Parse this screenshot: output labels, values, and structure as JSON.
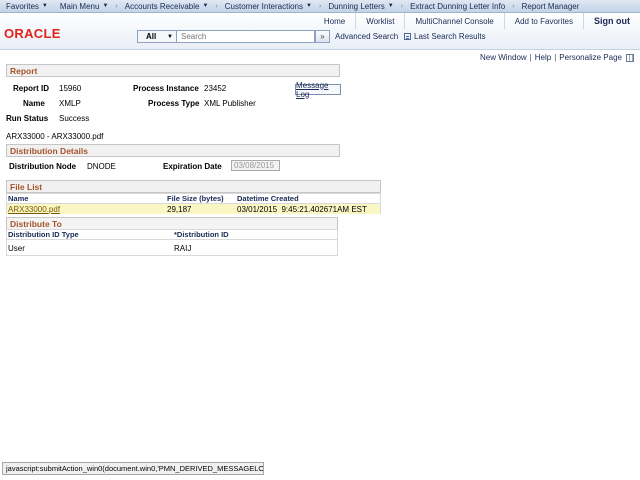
{
  "nav": {
    "items": [
      {
        "label": "Favorites",
        "caret": true
      },
      {
        "label": "Main Menu",
        "caret": true
      },
      {
        "label": "Accounts Receivable",
        "caret": true
      },
      {
        "label": "Customer Interactions",
        "caret": true
      },
      {
        "label": "Dunning Letters",
        "caret": true
      },
      {
        "label": "Extract Dunning Letter Info",
        "caret": false
      },
      {
        "label": "Report Manager",
        "caret": false
      }
    ],
    "caret_glyph": "▼",
    "sep_glyph": "›"
  },
  "header": {
    "logo": "ORACLE",
    "links": [
      "Home",
      "Worklist",
      "MultiChannel Console",
      "Add to Favorites"
    ],
    "signout": "Sign out",
    "search_scope": "All",
    "search_placeholder": "Search",
    "search_go": "»",
    "advanced_search": "Advanced Search",
    "last_search_results": "Last Search Results"
  },
  "page_links": {
    "new_window": "New Window",
    "help": "Help",
    "personalize": "Personalize Page",
    "sep": "|"
  },
  "report": {
    "section_title": "Report",
    "report_id_label": "Report ID",
    "report_id": "15960",
    "process_instance_label": "Process Instance",
    "process_instance": "23452",
    "message_log": "Message Log",
    "name_label": "Name",
    "name": "XMLP",
    "process_type_label": "Process Type",
    "process_type": "XML Publisher",
    "run_status_label": "Run Status",
    "run_status": "Success",
    "file_title": "ARX33000 - ARX33000.pdf"
  },
  "distribution": {
    "section_title": "Distribution Details",
    "node_label": "Distribution Node",
    "node": "DNODE",
    "exp_label": "Expiration Date",
    "exp_date": "03/08/2015"
  },
  "file_list": {
    "section_title": "File List",
    "columns": [
      "Name",
      "File Size (bytes)",
      "Datetime Created"
    ],
    "rows": [
      {
        "name": "ARX33000.pdf",
        "size": "29,187",
        "created": "03/01/2015  9:45:21.402671AM EST"
      }
    ]
  },
  "distribute_to": {
    "section_title": "Distribute To",
    "columns": [
      "Distribution ID Type",
      "*Distribution ID"
    ],
    "rows": [
      {
        "type": "User",
        "id": "RAIJ"
      }
    ]
  },
  "status_bar": "javascript:submitAction_win0(document.win0,'PMN_DERIVED_MESSAGELO..."
}
